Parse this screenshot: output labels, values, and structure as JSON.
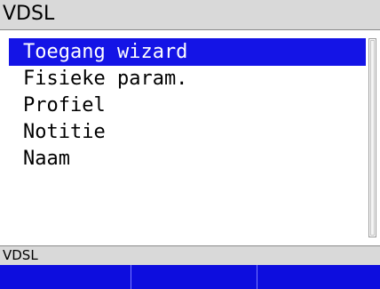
{
  "title_bar": {
    "title": "VDSL"
  },
  "menu": {
    "items": [
      {
        "label": "Toegang wizard",
        "selected": true
      },
      {
        "label": "Fisieke param.",
        "selected": false
      },
      {
        "label": "Profiel",
        "selected": false
      },
      {
        "label": "Notitie",
        "selected": false
      },
      {
        "label": "Naam",
        "selected": false
      }
    ]
  },
  "status_bar": {
    "text": "VDSL"
  },
  "softkeys": [
    {
      "label": ""
    },
    {
      "label": ""
    },
    {
      "label": ""
    }
  ],
  "colors": {
    "selection": "#1414e6",
    "softkey_bar": "#0d0dde",
    "bar_gray": "#d9d9d9"
  }
}
